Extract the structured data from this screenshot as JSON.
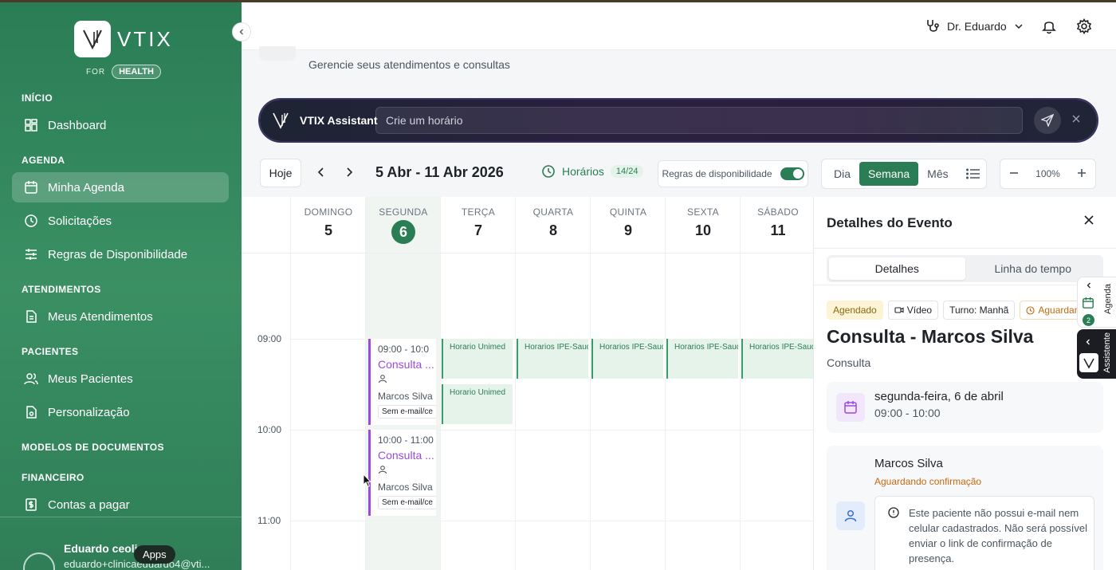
{
  "sidebar": {
    "logo_text": "VTIX",
    "for_label": "FOR",
    "health_label": "HEALTH",
    "sections": {
      "inicio": "INÍCIO",
      "agenda": "AGENDA",
      "atendimentos": "ATENDIMENTOS",
      "pacientes": "PACIENTES",
      "modelos": "MODELOS DE DOCUMENTOS",
      "financeiro": "FINANCEIRO"
    },
    "items": {
      "dashboard": "Dashboard",
      "minha_agenda": "Minha Agenda",
      "solicitacoes": "Solicitações",
      "regras": "Regras de Disponibilidade",
      "meus_atendimentos": "Meus Atendimentos",
      "meus_pacientes": "Meus Pacientes",
      "personalizacao": "Personalização",
      "contas": "Contas a pagar"
    },
    "user": {
      "name": "Eduardo ceoli",
      "email": "eduardo+clinicaeduardo4@vti..."
    },
    "apps_tooltip": "Apps"
  },
  "header": {
    "doctor": "Dr. Eduardo",
    "subtitle": "Gerencie seus atendimentos e consultas"
  },
  "assistant": {
    "label": "VTIX Assistant",
    "placeholder": "Crie um horário"
  },
  "toolbar": {
    "today": "Hoje",
    "range": "5 Abr - 11 Abr 2026",
    "horarios_label": "Horários",
    "horarios_count": "14/24",
    "rules_label": "Regras de disponibilidade",
    "views": {
      "day": "Dia",
      "week": "Semana",
      "month": "Mês"
    },
    "active_view": "Semana",
    "zoom": "100%"
  },
  "calendar": {
    "days": [
      {
        "name": "DOMINGO",
        "num": "5"
      },
      {
        "name": "SEGUNDA",
        "num": "6"
      },
      {
        "name": "TERÇA",
        "num": "7"
      },
      {
        "name": "QUARTA",
        "num": "8"
      },
      {
        "name": "QUINTA",
        "num": "9"
      },
      {
        "name": "SEXTA",
        "num": "10"
      },
      {
        "name": "SÁBADO",
        "num": "11"
      }
    ],
    "today_index": 1,
    "hours": [
      "09:00",
      "10:00",
      "11:00"
    ],
    "slots": {
      "unimed": "Horario Unimed",
      "ipe": "Horarios IPE-Saud"
    },
    "events": [
      {
        "time": "09:00 - 10:0",
        "title": "Consulta ...",
        "person": "Marcos Silva",
        "tag": "Sem e-mail/ce"
      },
      {
        "time": "10:00 - 11:00",
        "title": "Consulta ...",
        "person": "Marcos Silva",
        "tag": "Sem e-mail/ce"
      }
    ]
  },
  "details": {
    "title": "Detalhes do Evento",
    "tabs": {
      "details": "Detalhes",
      "timeline": "Linha do tempo"
    },
    "chips": {
      "status": "Agendado",
      "mode": "Vídeo",
      "shift": "Turno: Manhã",
      "waiting": "Aguardan"
    },
    "event_title": "Consulta - Marcos Silva",
    "event_type": "Consulta",
    "date_main": "segunda-feira, 6 de abril",
    "date_sub": "09:00 - 10:00",
    "patient_name": "Marcos Silva",
    "patient_status": "Aguardando confirmação",
    "warning": "Este paciente não possui e-mail nem celular cadastrados. Não será possível enviar o link de confirmação de presença."
  },
  "side_widgets": {
    "agenda_label": "Agenda",
    "agenda_count": "2",
    "assistant_label": "Assistente"
  },
  "colors": {
    "brand_green": "#2a7d55",
    "event_purple": "#9b4ae0",
    "warning_orange": "#c46a10"
  }
}
